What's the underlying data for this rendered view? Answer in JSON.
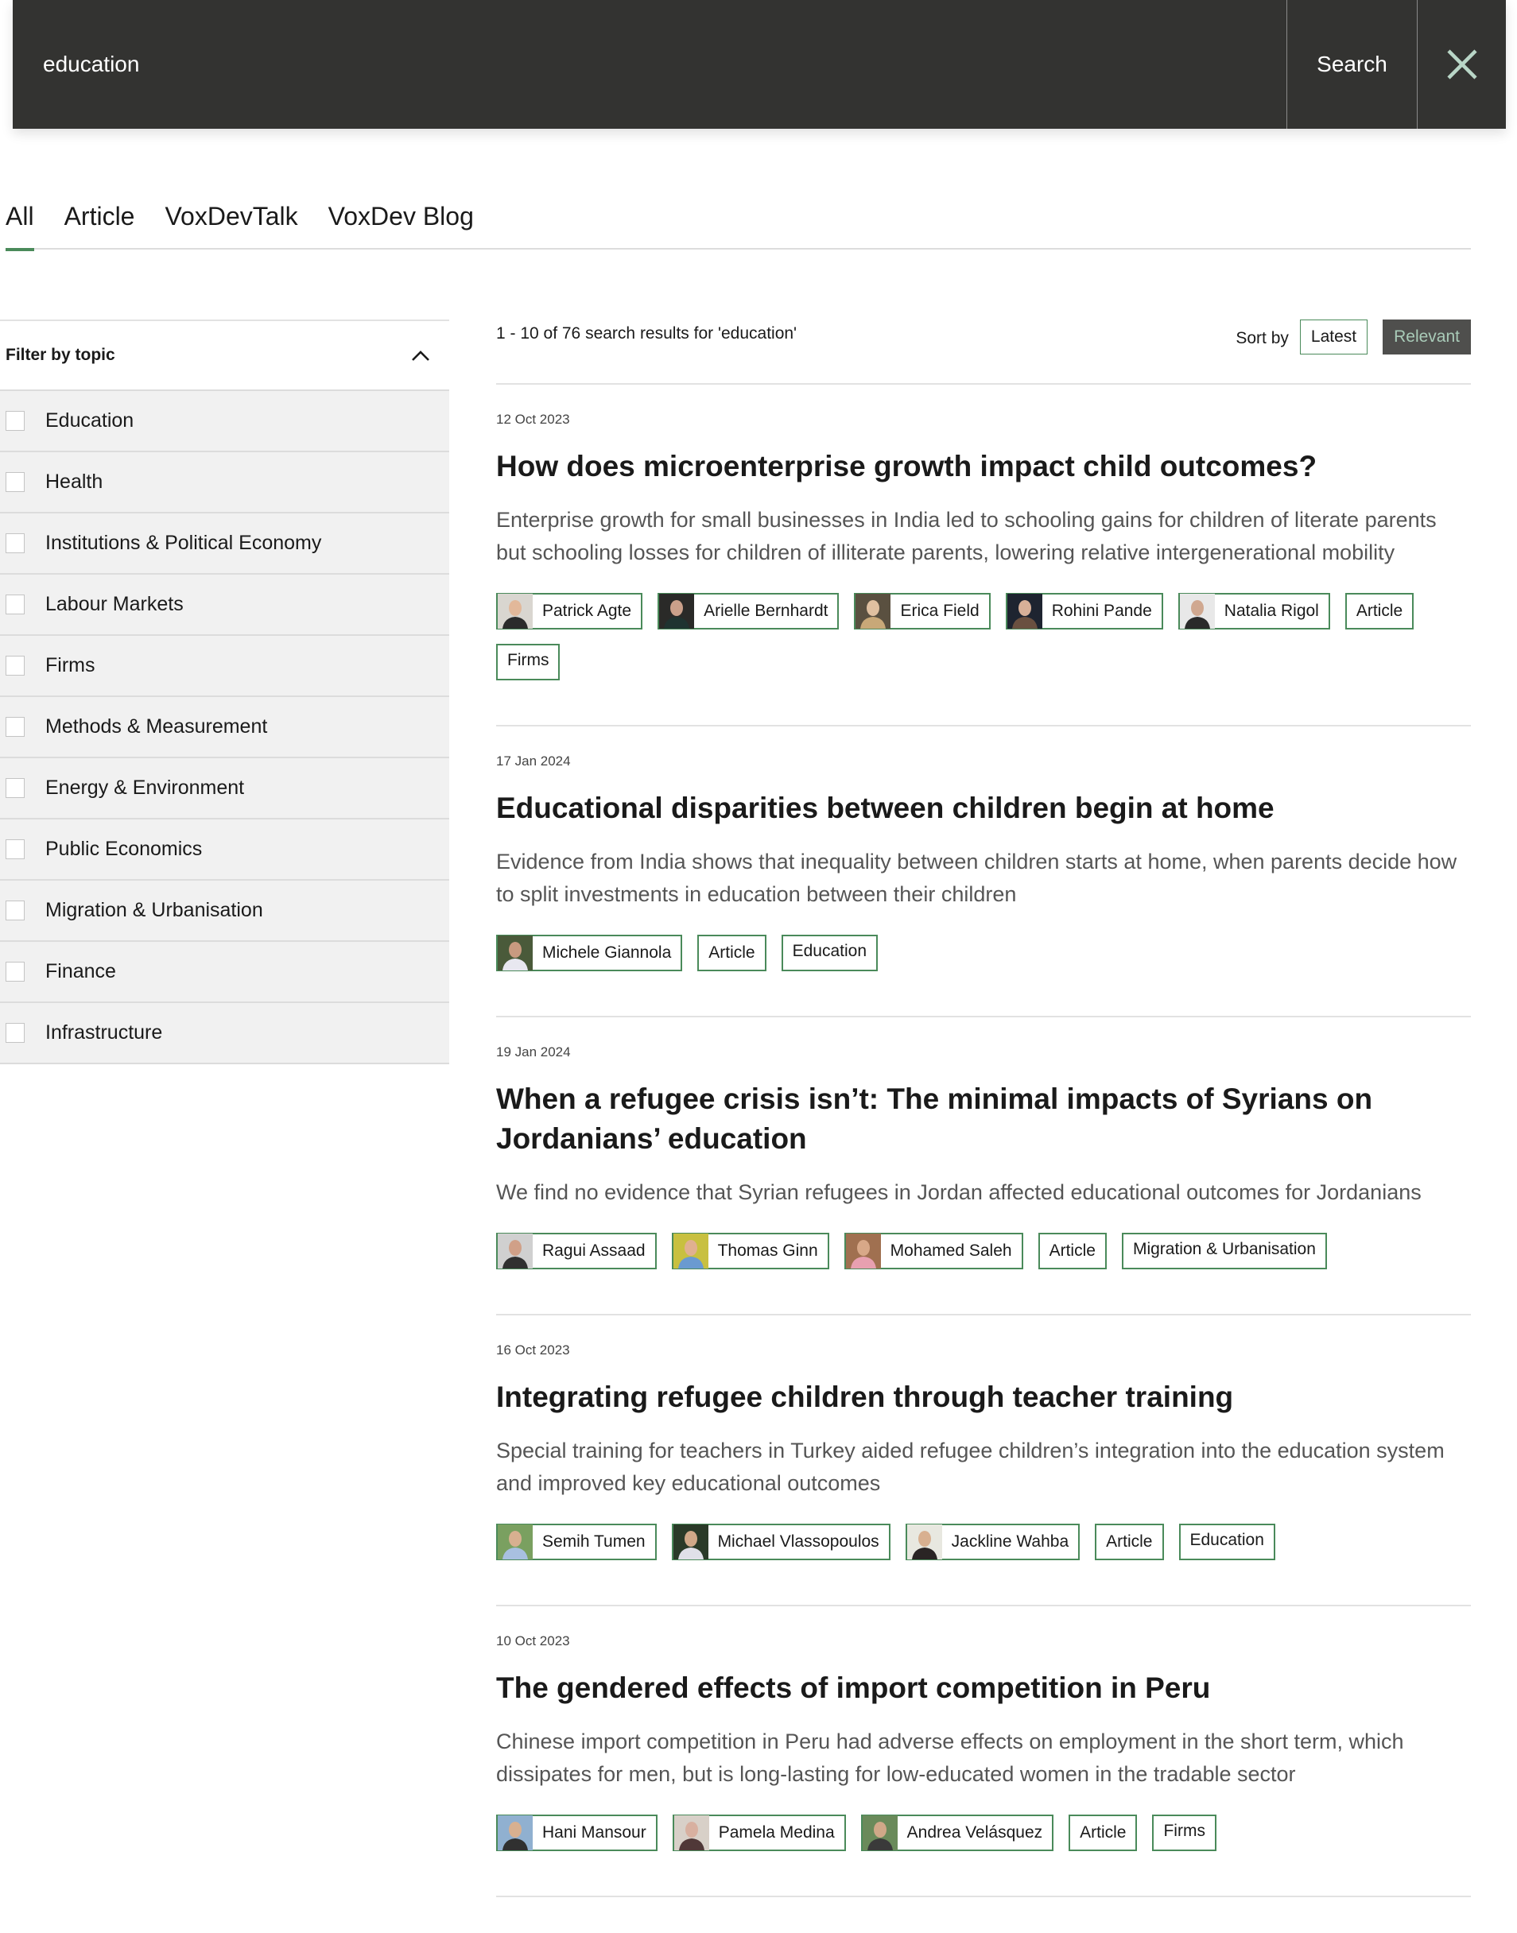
{
  "search": {
    "query": "education",
    "button_label": "Search",
    "close_icon": "close-icon"
  },
  "tabs": [
    {
      "label": "All",
      "active": true
    },
    {
      "label": "Article",
      "active": false
    },
    {
      "label": "VoxDevTalk",
      "active": false
    },
    {
      "label": "VoxDev Blog",
      "active": false
    }
  ],
  "sidebar": {
    "filter_title": "Filter by topic",
    "toggle_icon": "chevron-up-icon",
    "topics": [
      {
        "label": "Education",
        "checked": false
      },
      {
        "label": "Health",
        "checked": false
      },
      {
        "label": "Institutions & Political Economy",
        "checked": false
      },
      {
        "label": "Labour Markets",
        "checked": false
      },
      {
        "label": "Firms",
        "checked": false
      },
      {
        "label": "Methods & Measurement",
        "checked": false
      },
      {
        "label": "Energy & Environment",
        "checked": false
      },
      {
        "label": "Public Economics",
        "checked": false
      },
      {
        "label": "Migration & Urbanisation",
        "checked": false
      },
      {
        "label": "Finance",
        "checked": false
      },
      {
        "label": "Infrastructure",
        "checked": false
      }
    ]
  },
  "results_header": {
    "count_text": "1 - 10 of 76 search results for 'education'",
    "sort_label": "Sort by",
    "sort_options": [
      {
        "label": "Latest",
        "selected": false
      },
      {
        "label": "Relevant",
        "selected": true
      }
    ]
  },
  "results": [
    {
      "date": "12 Oct 2023",
      "title": "How does microenterprise growth impact child outcomes?",
      "description": "Enterprise growth for small businesses in India led to schooling gains for children of literate parents but schooling losses for children of illiterate parents, lowering relative intergenerational mobility",
      "authors": [
        "Patrick Agte",
        "Arielle Bernhardt",
        "Erica Field",
        "Rohini Pande",
        "Natalia Rigol"
      ],
      "tags": [
        "Article",
        "Firms"
      ]
    },
    {
      "date": "17 Jan 2024",
      "title": "Educational disparities between children begin at home",
      "description": "Evidence from India shows that inequality between children starts at home, when parents decide how to split investments in education between their children",
      "authors": [
        "Michele Giannola"
      ],
      "tags": [
        "Article",
        "Education"
      ]
    },
    {
      "date": "19 Jan 2024",
      "title": "When a refugee crisis isn’t: The minimal impacts of Syrians on Jordanians’ education",
      "description": "We find no evidence that Syrian refugees in Jordan affected educational outcomes for Jordanians",
      "authors": [
        "Ragui Assaad",
        "Thomas Ginn",
        "Mohamed Saleh"
      ],
      "tags": [
        "Article",
        "Migration & Urbanisation"
      ]
    },
    {
      "date": "16 Oct 2023",
      "title": "Integrating refugee children through teacher training",
      "description": "Special training for teachers in Turkey aided refugee children’s integration into the education system and improved key educational outcomes",
      "authors": [
        "Semih Tumen",
        "Michael Vlassopoulos",
        "Jackline Wahba"
      ],
      "tags": [
        "Article",
        "Education"
      ]
    },
    {
      "date": "10 Oct 2023",
      "title": "The gendered effects of import competition in Peru",
      "description": "Chinese import competition in Peru had adverse effects on employment in the short term, which dissipates for men, but is long-lasting for low-educated women in the tradable sector",
      "authors": [
        "Hani Mansour",
        "Pamela Medina",
        "Andrea Velásquez"
      ],
      "tags": [
        "Article",
        "Firms"
      ]
    }
  ],
  "colors": {
    "search_bg": "#333331",
    "accent_green": "#4a8a5a",
    "close_icon": "#b9d6c7",
    "relevant_bg": "#4f4f4d",
    "relevant_text": "#a9cbb8",
    "filter_bg": "#f1f1f1"
  }
}
